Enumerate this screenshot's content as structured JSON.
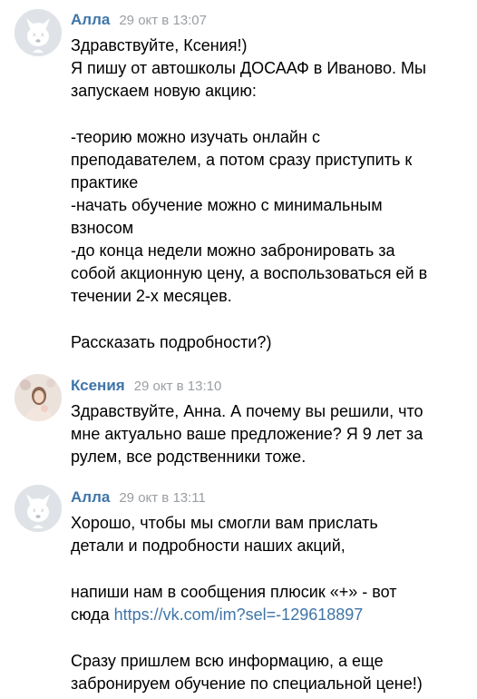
{
  "messages": [
    {
      "author": "Алла",
      "time": "29 окт в 13:07",
      "lines": [
        "Здравствуйте, Ксения!)",
        "Я пишу от автошколы ДОСААФ в Иваново. Мы",
        "запускаем новую акцию:",
        "",
        "-теорию можно изучать онлайн с",
        "преподавателем, а потом сразу приступить к",
        "практике",
        "-начать обучение можно с минимальным",
        "взносом",
        "-до конца недели можно забронировать за",
        "собой акционную цену, а воспользоваться ей в",
        "течении 2-х месяцев.",
        "",
        "Рассказать подробности?)"
      ]
    },
    {
      "author": "Ксения",
      "time": "29 окт в 13:10",
      "lines": [
        "Здравствуйте, Анна. А почему вы решили, что",
        "мне актуально ваше предложение? Я 9 лет за",
        "рулем, все родственники тоже."
      ]
    },
    {
      "author": "Алла",
      "time": "29 окт в 13:11",
      "lines_before": [
        "Хорошо, чтобы мы смогли вам прислать",
        "детали и подробности наших акций,",
        "",
        "напиши нам в сообщения плюсик «+» - вот"
      ],
      "link_prefix": "сюда ",
      "link": "https://vk.com/im?sel=-129618897",
      "lines_after": [
        "",
        "Сразу пришлем всю информацию, а еще",
        "забронируем обучение по специальной цене!)"
      ]
    }
  ],
  "colors": {
    "name": "#3f75a8",
    "time": "#9a9ea3",
    "link": "#3f75a8",
    "text": "#000000"
  }
}
